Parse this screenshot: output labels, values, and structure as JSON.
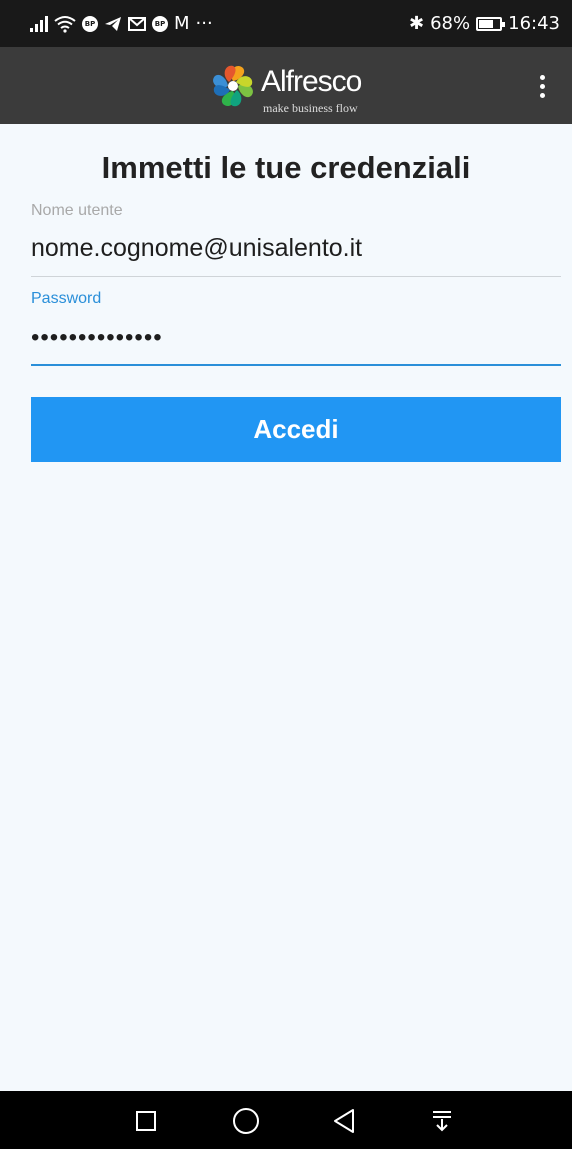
{
  "status_bar": {
    "notification_icons": [
      "signal-icon",
      "wifi-icon",
      "bp-app-icon",
      "telegram-icon",
      "gmail-icon",
      "bp-app-icon",
      "mcdonalds-icon",
      "more-notifications-icon"
    ],
    "mcdonalds_glyph": "M",
    "more_glyph": "···",
    "bluetooth_glyph": "✱",
    "battery_percent": "68%",
    "battery_level": 0.68,
    "time": "16:43"
  },
  "header": {
    "logo_name": "Alfresco",
    "logo_tagline": "make business flow",
    "menu_icon": "more-vertical-icon",
    "background": "#3b3b3b"
  },
  "form": {
    "title": "Immetti le tue credenziali",
    "username_label": "Nome utente",
    "username_value": "nome.cognome@unisalento.it",
    "password_label": "Password",
    "password_value": "••••••••••••••",
    "submit_label": "Accedi",
    "accent_color": "#2196f3"
  },
  "nav_bar": {
    "buttons": [
      "recent-apps-icon",
      "home-icon",
      "back-icon",
      "notifications-pulldown-icon"
    ]
  }
}
